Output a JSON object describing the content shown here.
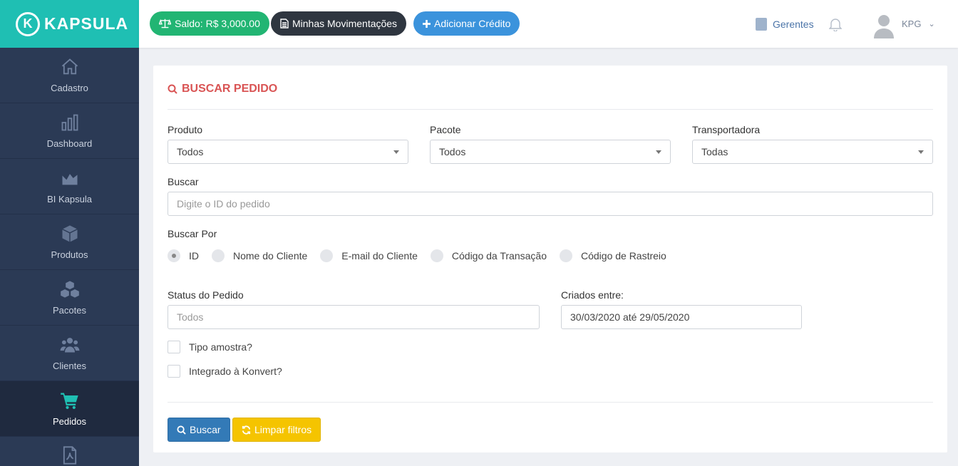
{
  "brand": {
    "mark": "K",
    "name": "KAPSULA"
  },
  "sidebar": {
    "items": [
      {
        "label": "Cadastro",
        "icon": "home-icon"
      },
      {
        "label": "Dashboard",
        "icon": "bar-chart-icon"
      },
      {
        "label": "BI Kapsula",
        "icon": "area-chart-icon"
      },
      {
        "label": "Produtos",
        "icon": "box-icon"
      },
      {
        "label": "Pacotes",
        "icon": "boxes-icon"
      },
      {
        "label": "Clientes",
        "icon": "users-icon"
      },
      {
        "label": "Pedidos",
        "icon": "cart-icon",
        "active": true
      },
      {
        "label": "",
        "icon": "pdf-file-icon"
      }
    ]
  },
  "header": {
    "saldo": "Saldo: R$ 3,000.00",
    "movimentacoes": "Minhas Movimentações",
    "adicionar": "Adicionar Crédito",
    "gerentes": "Gerentes",
    "user": "KPG"
  },
  "form": {
    "title": "BUSCAR PEDIDO",
    "produto": {
      "label": "Produto",
      "value": "Todos"
    },
    "pacote": {
      "label": "Pacote",
      "value": "Todos"
    },
    "transportadora": {
      "label": "Transportadora",
      "value": "Todas"
    },
    "buscar": {
      "label": "Buscar",
      "placeholder": "Digite o ID do pedido"
    },
    "buscar_por": {
      "label": "Buscar Por",
      "options": [
        "ID",
        "Nome do Cliente",
        "E-mail do Cliente",
        "Código da Transação",
        "Código de Rastreio"
      ],
      "selected": "ID"
    },
    "status": {
      "label": "Status do Pedido",
      "placeholder": "Todos"
    },
    "criados": {
      "label": "Criados entre:",
      "value": "30/03/2020 até 29/05/2020"
    },
    "tipo_amostra": "Tipo amostra?",
    "integrado": "Integrado à Konvert?",
    "btn_buscar": "Buscar",
    "btn_limpar": "Limpar filtros"
  },
  "colors": {
    "sidebar": "#2b3a55",
    "logo_bg": "#1fbfb3",
    "title_red": "#d95454",
    "saldo_green": "#22b573",
    "add_blue": "#3b93dc",
    "buscar_blue": "#337ab7",
    "limpar_yellow": "#f5c400"
  }
}
